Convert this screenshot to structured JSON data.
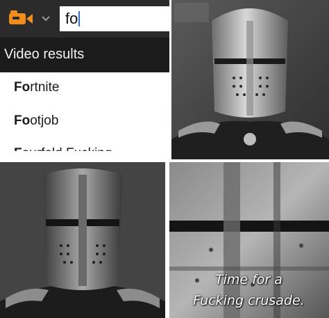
{
  "search": {
    "query": "fo",
    "section_header": "Video results",
    "results": [
      {
        "bold": "Fo",
        "rest": "rtnite"
      },
      {
        "bold": "Fo",
        "rest": "otjob"
      },
      {
        "bold": "F",
        "rest": "ourfold Fucking"
      }
    ]
  },
  "meme": {
    "caption_line1": "Time for a",
    "caption_line2": "Fucking crusade."
  },
  "colors": {
    "camera_icon": "#f08c1a",
    "search_bar": "#2b2b2b",
    "results_header": "#1b1b1b"
  },
  "icons": [
    "video-camera-icon",
    "chevron-down-icon",
    "text-caret"
  ]
}
